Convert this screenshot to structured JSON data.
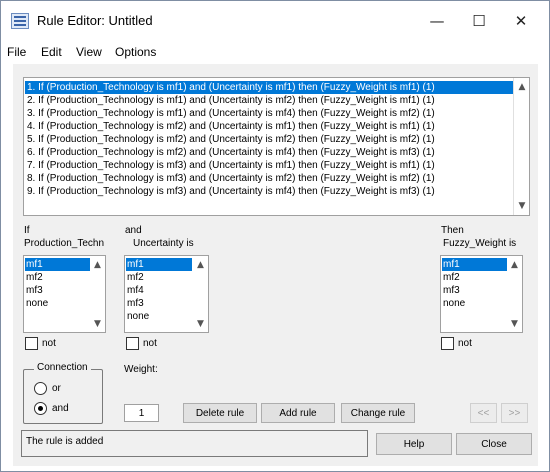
{
  "window": {
    "title": "Rule Editor: Untitled",
    "minimize": "—",
    "maximize": "☐",
    "close": "✕"
  },
  "menu": [
    "File",
    "Edit",
    "View",
    "Options"
  ],
  "rules": [
    "1. If (Production_Technology is mf1) and (Uncertainty is mf1) then (Fuzzy_Weight is mf1) (1)",
    "2. If (Production_Technology is mf1) and (Uncertainty is mf2) then (Fuzzy_Weight is mf1) (1)",
    "3. If (Production_Technology is mf1) and (Uncertainty is mf4) then (Fuzzy_Weight is mf2) (1)",
    "4. If (Production_Technology is mf2) and (Uncertainty is mf1) then (Fuzzy_Weight is mf1) (1)",
    "5. If (Production_Technology is mf2) and (Uncertainty is mf2) then (Fuzzy_Weight is mf2) (1)",
    "6. If (Production_Technology is mf2) and (Uncertainty is mf4) then (Fuzzy_Weight is mf3) (1)",
    "7. If (Production_Technology is mf3) and (Uncertainty is mf1) then (Fuzzy_Weight is mf1) (1)",
    "8. If (Production_Technology is mf3) and (Uncertainty is mf2) then (Fuzzy_Weight is mf2) (1)",
    "9. If (Production_Technology is mf3) and (Uncertainty is mf4) then (Fuzzy_Weight is mf3) (1)"
  ],
  "selected_rule": 1,
  "inputs": {
    "if": {
      "prefix": "If",
      "name": "Production_Techn",
      "items": [
        "mf1",
        "mf2",
        "mf3",
        "none"
      ],
      "selected": "mf1"
    },
    "and": {
      "prefix": "and",
      "name": "Uncertainty is",
      "items": [
        "mf1",
        "mf2",
        "mf4",
        "mf3",
        "none"
      ],
      "selected": "mf1"
    },
    "then": {
      "prefix": "Then",
      "name": "Fuzzy_Weight is",
      "items": [
        "mf1",
        "mf2",
        "mf3",
        "none"
      ],
      "selected": "mf1"
    }
  },
  "not_label": "not",
  "connection": {
    "title": "Connection",
    "options": [
      "or",
      "and"
    ],
    "selected": "and"
  },
  "weight": {
    "label": "Weight:",
    "value": "1"
  },
  "buttons": {
    "delete": "Delete rule",
    "add": "Add rule",
    "change": "Change rule",
    "prev": "<<",
    "next": ">>",
    "help": "Help",
    "close": "Close"
  },
  "status": "The rule is added",
  "colors": {
    "selection": "#0078d7",
    "panel": "#f0f0f0"
  }
}
